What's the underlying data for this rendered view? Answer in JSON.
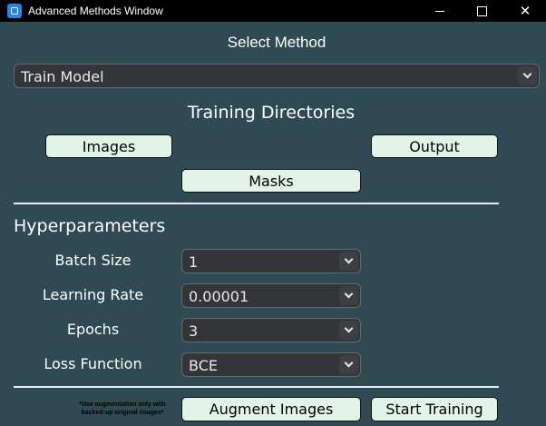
{
  "window": {
    "title": "Advanced Methods Window",
    "controls": {
      "minimize": "minimize",
      "maximize": "maximize",
      "close": "✕"
    }
  },
  "method": {
    "heading": "Select Method",
    "selected": "Train Model"
  },
  "directories": {
    "heading": "Training Directories",
    "images_label": "Images",
    "output_label": "Output",
    "masks_label": "Masks"
  },
  "hyperparameters": {
    "heading": "Hyperparameters",
    "batch_size": {
      "label": "Batch Size",
      "value": "1"
    },
    "learning_rate": {
      "label": "Learning Rate",
      "value": "0.00001"
    },
    "epochs": {
      "label": "Epochs",
      "value": "3"
    },
    "loss_function": {
      "label": "Loss Function",
      "value": "BCE"
    }
  },
  "footer": {
    "note_line1": "*Use augmentation only with",
    "note_line2": "backed-up original images*",
    "augment_label": "Augment Images",
    "start_label": "Start Training"
  },
  "colors": {
    "background": "#2f4a52",
    "button": "#e2f4e7",
    "select": "#333538",
    "titlebar": "#000000"
  },
  "icons": {
    "app": "app-icon",
    "dropdown": "chevron-down-icon"
  }
}
